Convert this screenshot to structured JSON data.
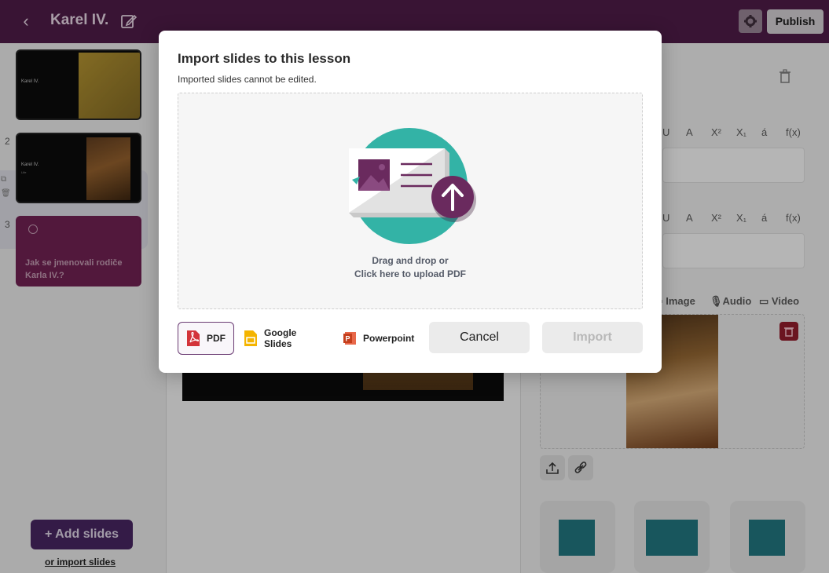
{
  "topbar": {
    "title": "Karel IV.",
    "publish_label": "Publish"
  },
  "sidebar": {
    "slides": [
      {
        "number": "",
        "title": "Karel IV.",
        "subtitle": ""
      },
      {
        "number": "2",
        "title": "Karel IV.",
        "subtitle": "Life"
      },
      {
        "number": "3",
        "quiz_text": "Jak se jmenovali rodiče Karla IV.?"
      }
    ],
    "add_slides_label": "Add slides",
    "import_link": "or import slides"
  },
  "right_panel": {
    "format_tools": [
      "U",
      "A",
      "X²",
      "X₁",
      "á",
      "f(x)"
    ],
    "media_tabs": {
      "image": "Image",
      "audio": "Audio",
      "video": "Video"
    }
  },
  "modal": {
    "title": "Import slides to this lesson",
    "subtitle": "Imported slides cannot be edited.",
    "drop_line1": "Drag and drop or",
    "drop_line2": "Click here to upload PDF",
    "sources": [
      {
        "label": "PDF",
        "icon": "pdf-icon",
        "active": true
      },
      {
        "label": "Google Slides",
        "icon": "google-slides-icon",
        "active": false
      },
      {
        "label": "Powerpoint",
        "icon": "powerpoint-icon",
        "active": false
      }
    ],
    "cancel_label": "Cancel",
    "import_label": "Import"
  },
  "colors": {
    "brand": "#4a1a43",
    "teal": "#33b3a6",
    "purple": "#6a2a5e",
    "pdf_red": "#d3343a",
    "slides_yellow": "#f4b400",
    "ppt_red": "#c43e1c"
  }
}
